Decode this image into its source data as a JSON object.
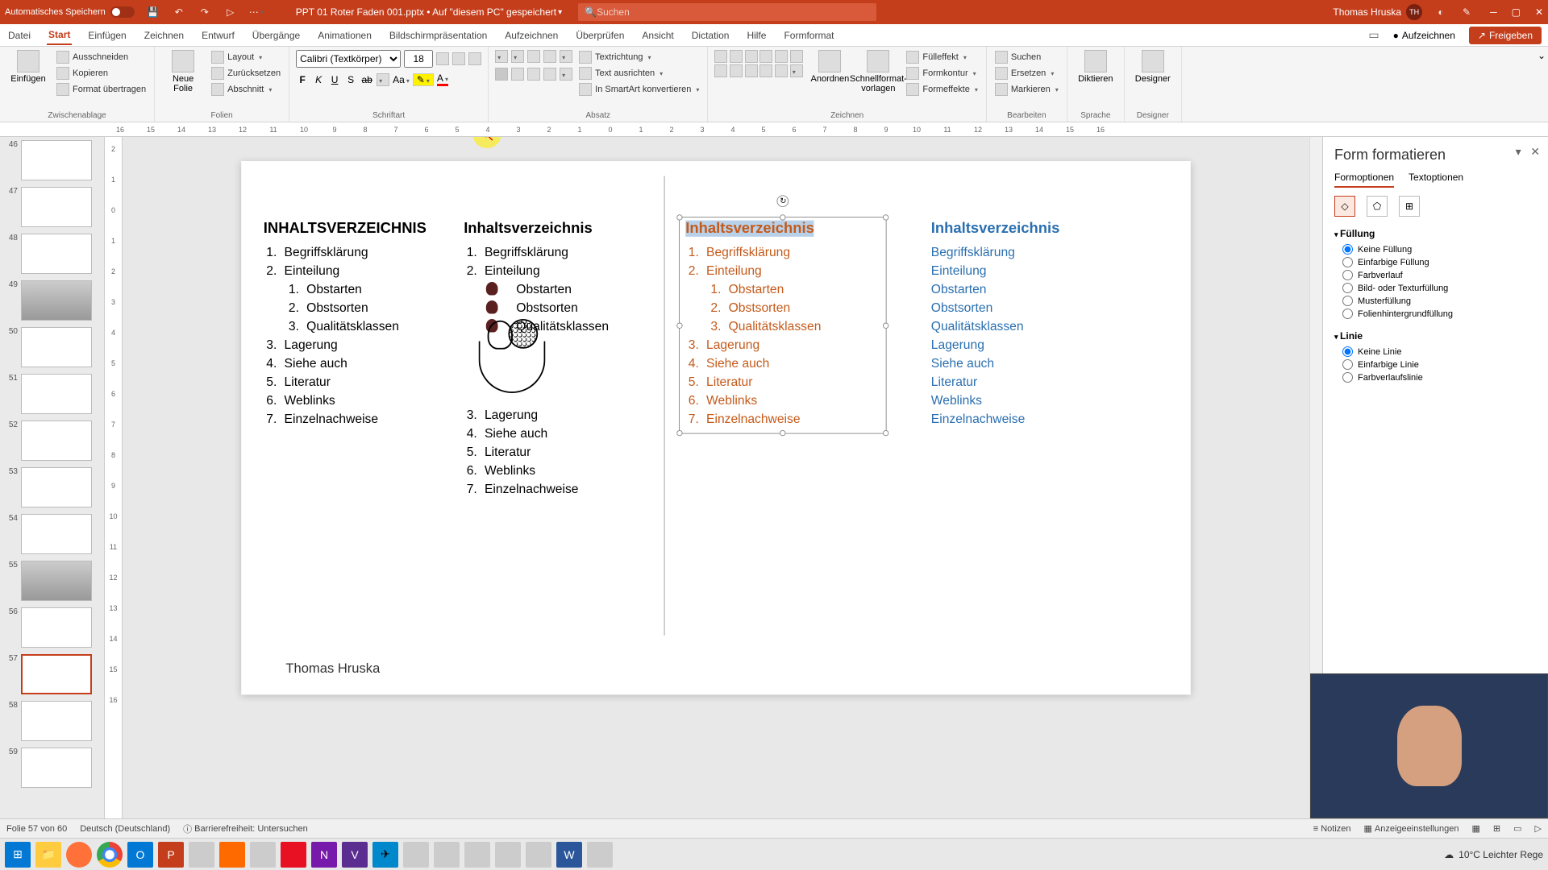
{
  "titlebar": {
    "autosave": "Automatisches Speichern",
    "filename": "PPT 01 Roter Faden 001.pptx • Auf \"diesem PC\" gespeichert ",
    "search_placeholder": "Suchen",
    "user": "Thomas Hruska",
    "user_initials": "TH"
  },
  "tabs": [
    "Datei",
    "Start",
    "Einfügen",
    "Zeichnen",
    "Entwurf",
    "Übergänge",
    "Animationen",
    "Bildschirmpräsentation",
    "Aufzeichnen",
    "Überprüfen",
    "Ansicht",
    "Dictation",
    "Hilfe",
    "Formformat"
  ],
  "tabs_active_index": 1,
  "ribbon_right": {
    "record": "Aufzeichnen",
    "share": "Freigeben"
  },
  "ribbon": {
    "clipboard": {
      "paste": "Einfügen",
      "cut": "Ausschneiden",
      "copy": "Kopieren",
      "format_painter": "Format übertragen",
      "label": "Zwischenablage"
    },
    "slides": {
      "new": "Neue\nFolie",
      "layout": "Layout",
      "reset": "Zurücksetzen",
      "section": "Abschnitt",
      "label": "Folien"
    },
    "font": {
      "name": "Calibri (Textkörper)",
      "size": "18",
      "label": "Schriftart"
    },
    "paragraph": {
      "textdir": "Textrichtung",
      "align": "Text ausrichten",
      "smartart": "In SmartArt konvertieren",
      "label": "Absatz"
    },
    "drawing": {
      "arrange": "Anordnen",
      "quick": "Schnellformat-\nvorlagen",
      "fill": "Fülleffekt",
      "outline": "Formkontur",
      "effects": "Formeffekte",
      "label": "Zeichnen"
    },
    "editing": {
      "find": "Suchen",
      "replace": "Ersetzen",
      "select": "Markieren",
      "label": "Bearbeiten"
    },
    "voice": {
      "dictate": "Diktieren",
      "label": "Sprache"
    },
    "designer": {
      "btn": "Designer",
      "label": "Designer"
    }
  },
  "ruler_h": [
    "16",
    "15",
    "14",
    "13",
    "12",
    "11",
    "10",
    "9",
    "8",
    "7",
    "6",
    "5",
    "4",
    "3",
    "2",
    "1",
    "0",
    "1",
    "2",
    "3",
    "4",
    "5",
    "6",
    "7",
    "8",
    "9",
    "10",
    "11",
    "12",
    "13",
    "14",
    "15",
    "16"
  ],
  "ruler_v": [
    "2",
    "1",
    "0",
    "1",
    "2",
    "3",
    "4",
    "5",
    "6",
    "7",
    "8",
    "9",
    "10",
    "11",
    "12",
    "13",
    "14",
    "15",
    "16"
  ],
  "thumbs": [
    46,
    47,
    48,
    49,
    50,
    51,
    52,
    53,
    54,
    55,
    56,
    57,
    58,
    59
  ],
  "thumb_active": 57,
  "slide": {
    "heading_uc": "INHALTSVERZEICHNIS",
    "heading": "Inhaltsverzeichnis",
    "items": [
      "Begriffsklärung",
      "Einteilung",
      "Lagerung",
      "Siehe auch",
      "Literatur",
      "Weblinks",
      "Einzelnachweise"
    ],
    "subitems": [
      "Obstarten",
      "Obstsorten",
      "Qualitätsklassen"
    ],
    "author": "Thomas Hruska"
  },
  "fpane": {
    "title": "Form formatieren",
    "tab1": "Formoptionen",
    "tab2": "Textoptionen",
    "fill": {
      "h": "Füllung",
      "none": "Keine Füllung",
      "solid": "Einfarbige Füllung",
      "gradient": "Farbverlauf",
      "picture": "Bild- oder Texturfüllung",
      "pattern": "Musterfüllung",
      "slidebg": "Folienhintergrundfüllung"
    },
    "line": {
      "h": "Linie",
      "none": "Keine Linie",
      "solid": "Einfarbige Linie",
      "gradient": "Farbverlaufslinie"
    }
  },
  "status": {
    "slide": "Folie 57 von 60",
    "lang": "Deutsch (Deutschland)",
    "access": "Barrierefreiheit: Untersuchen",
    "notes": "Notizen",
    "display": "Anzeigeeinstellungen"
  },
  "weather": "10°C   Leichter Rege"
}
